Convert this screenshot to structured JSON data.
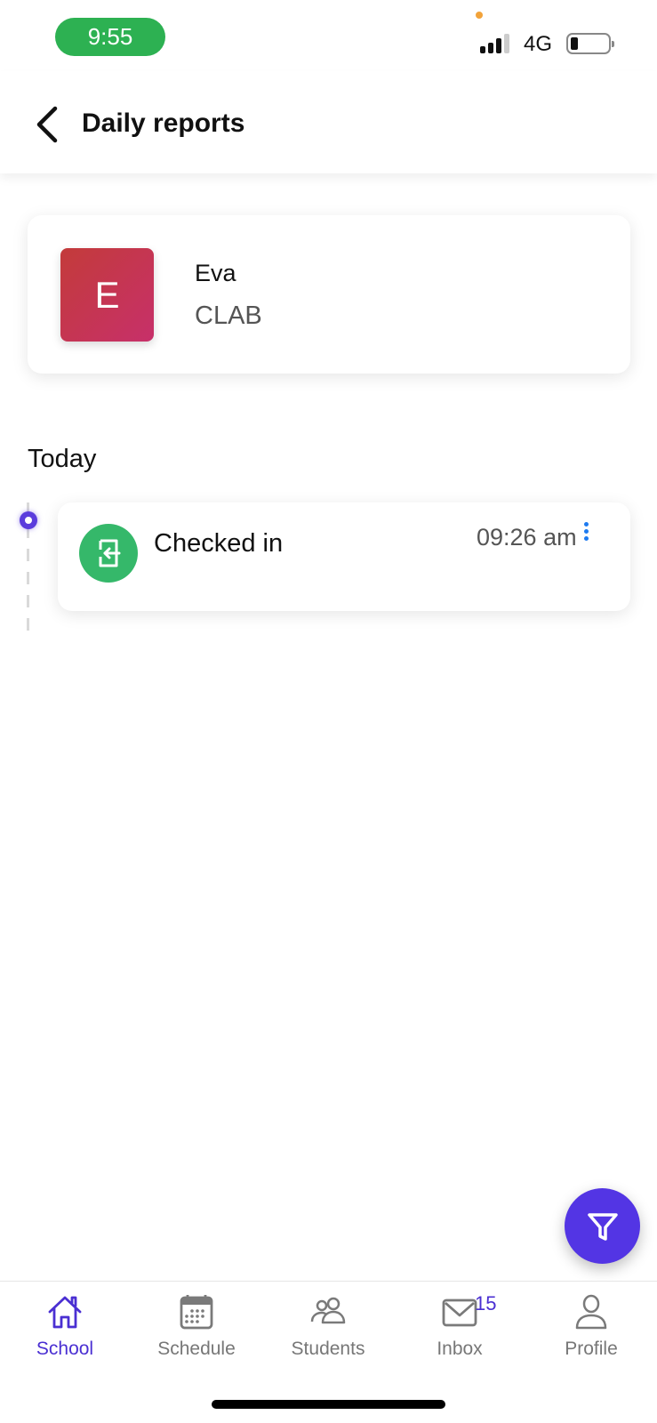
{
  "status_bar": {
    "time": "9:55",
    "network": "4G",
    "battery_level": 0.15,
    "signal_bars": 3
  },
  "header": {
    "title": "Daily reports",
    "back_icon": "chevron-left-icon"
  },
  "student": {
    "initial": "E",
    "name": "Eva",
    "class": "CLAB"
  },
  "timeline": {
    "section_label": "Today",
    "events": [
      {
        "icon": "check-in-icon",
        "label": "Checked in",
        "time": "09:26 am",
        "menu_icon": "more-vertical-icon"
      }
    ]
  },
  "fab": {
    "icon": "filter-icon"
  },
  "tab_bar": {
    "items": [
      {
        "label": "School",
        "icon": "home-icon",
        "active": true
      },
      {
        "label": "Schedule",
        "icon": "calendar-icon",
        "active": false
      },
      {
        "label": "Students",
        "icon": "users-icon",
        "active": false
      },
      {
        "label": "Inbox",
        "icon": "mail-icon",
        "active": false,
        "badge": "15"
      },
      {
        "label": "Profile",
        "icon": "user-icon",
        "active": false
      }
    ]
  },
  "colors": {
    "accent": "#5335e4",
    "status_time_bg": "#2db152",
    "checkin_green": "#35b86a",
    "avatar_gradient_start": "#c33b3a",
    "avatar_gradient_end": "#c7306a",
    "menu_dots": "#1e7bf0"
  }
}
